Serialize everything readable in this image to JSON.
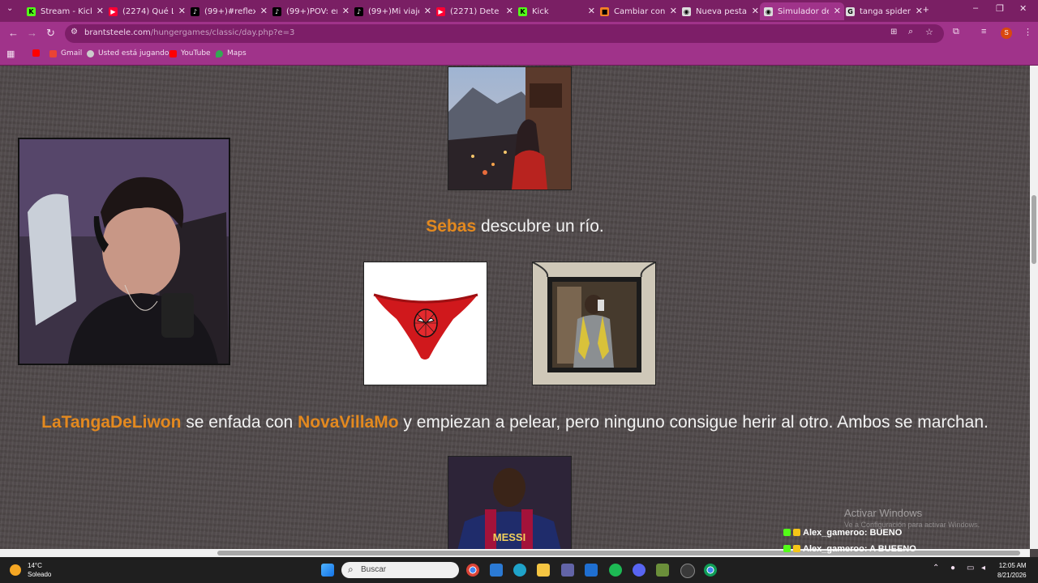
{
  "browser": {
    "tabs": [
      {
        "title": "Stream - Kick D",
        "color": "#53fc18",
        "glyph": "K"
      },
      {
        "title": "(2274) Qué Los",
        "color": "#ff0033",
        "glyph": "▶"
      },
      {
        "title": "(99+)#reflexion",
        "color": "#000000",
        "glyph": "♪"
      },
      {
        "title": "(99+)POV: entr",
        "color": "#000000",
        "glyph": "♪"
      },
      {
        "title": "(99+)Mi viaje p",
        "color": "#000000",
        "glyph": "♪"
      },
      {
        "title": "(2271) Dete",
        "color": "#ff0033",
        "glyph": "▶"
      },
      {
        "title": "Kick",
        "color": "#53fc18",
        "glyph": "K"
      },
      {
        "title": "Cambiar confi",
        "color": "#f48024",
        "glyph": "■"
      },
      {
        "title": "Nueva pestaña",
        "color": "#dddddd",
        "glyph": "◉"
      },
      {
        "title": "Simulador de",
        "color": "#dddddd",
        "glyph": "◉"
      },
      {
        "title": "tanga spiderm",
        "color": "#dddddd",
        "glyph": "G"
      }
    ],
    "active_tab": 9,
    "url_domain": "brantsteele.com",
    "url_path": "/hungergames/classic/day.php?e=3",
    "bookmarks": [
      {
        "label": "Gmail",
        "color": "#ea4335"
      },
      {
        "label": "Usted está jugando...",
        "color": "#cccccc"
      },
      {
        "label": "YouTube",
        "color": "#ff0000"
      },
      {
        "label": "Maps",
        "color": "#34a853"
      }
    ]
  },
  "events": [
    {
      "tribute": "Sebas",
      "text": "descubre un río."
    },
    {
      "tribute1": "LaTangaDeLiwon",
      "text1": "se enfada con",
      "tribute2": "NovaVillaMo",
      "text2": "y empiezan a pelear, pero ninguno consigue herir al otro. Ambos se marchan."
    }
  ],
  "photo_labels": {
    "jersey": "MESSI"
  },
  "overlay": {
    "chat": [
      {
        "user": "Alex_gameroo",
        "message": " : BUENO"
      },
      {
        "user": "Alex_gameroo",
        "message": " : A BUEENO"
      }
    ],
    "activate_windows": "Activar Windows",
    "activate_windows_sub": "Ve a Configuración para activar Windows."
  },
  "taskbar": {
    "weather_temp": "14°C",
    "weather_desc": "Soleado",
    "search_label": "Buscar",
    "time": "12:05 AM",
    "date": "8/21/2026"
  }
}
